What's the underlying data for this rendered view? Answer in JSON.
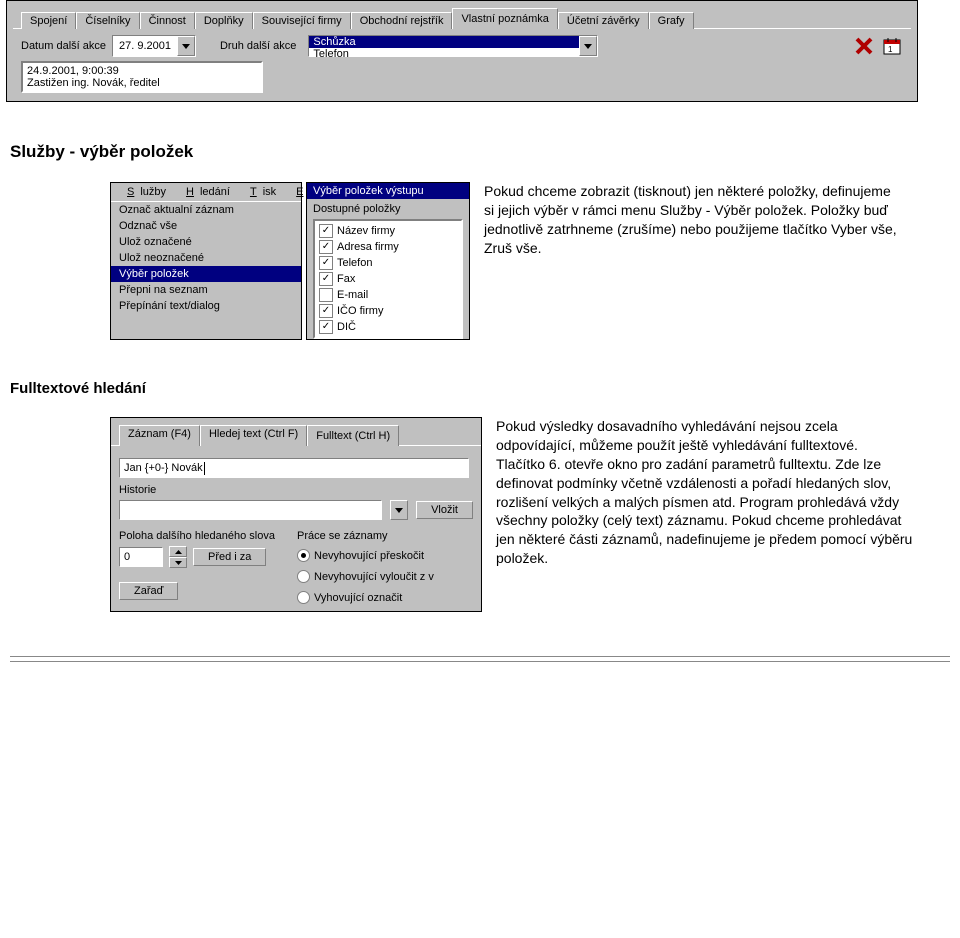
{
  "topPanel": {
    "tabs": [
      "Spojení",
      "Číselníky",
      "Činnost",
      "Doplňky",
      "Související firmy",
      "Obchodní rejstřík",
      "Vlastní poznámka",
      "Účetní závěrky",
      "Grafy"
    ],
    "activeTab": "Vlastní poznámka",
    "labelDatum": "Datum další akce",
    "dateValue": "27. 9.2001",
    "labelDruh": "Druh další akce",
    "druhOptions": [
      "Schůzka",
      "Telefon"
    ],
    "list1": "24.9.2001, 9:00:39",
    "list2": "Zastižen ing. Novák, ředitel"
  },
  "section1": {
    "heading": "Služby - výběr položek",
    "paragraph": "Pokud chceme zobrazit (tisknout) jen některé položky, definujeme si jejich výběr v rámci menu Služby - Výběr položek. Položky buď jednotlivě zatrhneme (zrušíme) nebo použijeme tlačítko Vyber vše, Zruš vše."
  },
  "menu": {
    "items": [
      {
        "t": "Služby",
        "u": "S"
      },
      {
        "t": "Hledání",
        "u": "H"
      },
      {
        "t": "Tisk",
        "u": "T"
      },
      {
        "t": "Expor",
        "u": "E"
      }
    ],
    "dropdown": [
      "Označ aktualní záznam",
      "Odznač vše",
      "Ulož označené",
      "Ulož neoznačené",
      "Výběr položek",
      "Přepni na seznam",
      "Přepínání text/dialog"
    ],
    "highlighted": "Výběr položek"
  },
  "panel2": {
    "title": "Výběr položek výstupu",
    "label": "Dostupné položky",
    "items": [
      {
        "label": "Název firmy",
        "checked": true
      },
      {
        "label": "Adresa firmy",
        "checked": true
      },
      {
        "label": "Telefon",
        "checked": true
      },
      {
        "label": "Fax",
        "checked": true
      },
      {
        "label": "E-mail",
        "checked": false
      },
      {
        "label": "IČO firmy",
        "checked": true
      },
      {
        "label": "DIČ",
        "checked": true
      }
    ]
  },
  "section2": {
    "heading": "Fulltextové hledání",
    "paragraph": "Pokud výsledky dosavadního vyhledávání nejsou zcela odpovídající, můžeme použít ještě vyhledávání fulltextové.\nTlačítko 6. otevře okno pro zadání parametrů fulltextu. Zde lze definovat podmínky včetně vzdálenosti a pořadí hledaných slov, rozlišení velkých a malých písmen atd. Program prohledává vždy všechny položky (celý text) záznamu. Pokud chceme prohledávat jen některé části záznamů, nadefinujeme je předem pomocí výběru položek."
  },
  "ft": {
    "tabs": [
      "Záznam (F4)",
      "Hledej text (Ctrl F)",
      "Fulltext (Ctrl H)"
    ],
    "activeTab": "Fulltext (Ctrl H)",
    "searchValue": "Jan {+0-} Novák",
    "labelHistorie": "Historie",
    "btnVlozit": "Vložit",
    "labelPoloha": "Poloha dalšího hledaného slova",
    "polohaValue": "0",
    "btnPredIZa": "Před i za",
    "btnZarad": "Zařaď",
    "labelPrace": "Práce se záznamy",
    "radios": [
      "Nevyhovující přeskočit",
      "Nevyhovující vyloučit z v",
      "Vyhovující označit"
    ],
    "radioSelected": 0
  }
}
